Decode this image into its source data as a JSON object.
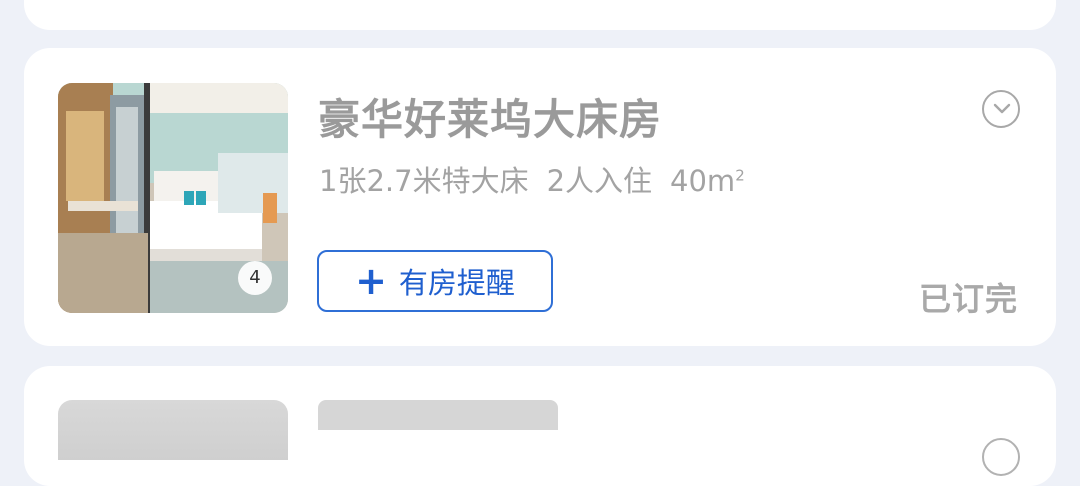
{
  "room": {
    "title": "豪华好莱坞大床房",
    "bed": "1张2.7米特大床",
    "guests": "2人入住",
    "area": "40m",
    "area_sup": "2",
    "photo_count": "4",
    "remind_label": "有房提醒",
    "status": "已订完",
    "expand_icon": "chevron-down-icon",
    "plus_icon": "plus-icon"
  },
  "colors": {
    "page_bg": "#eef1f8",
    "card_bg": "#ffffff",
    "accent": "#1f5fcf",
    "muted_text": "#9a9a9a"
  }
}
